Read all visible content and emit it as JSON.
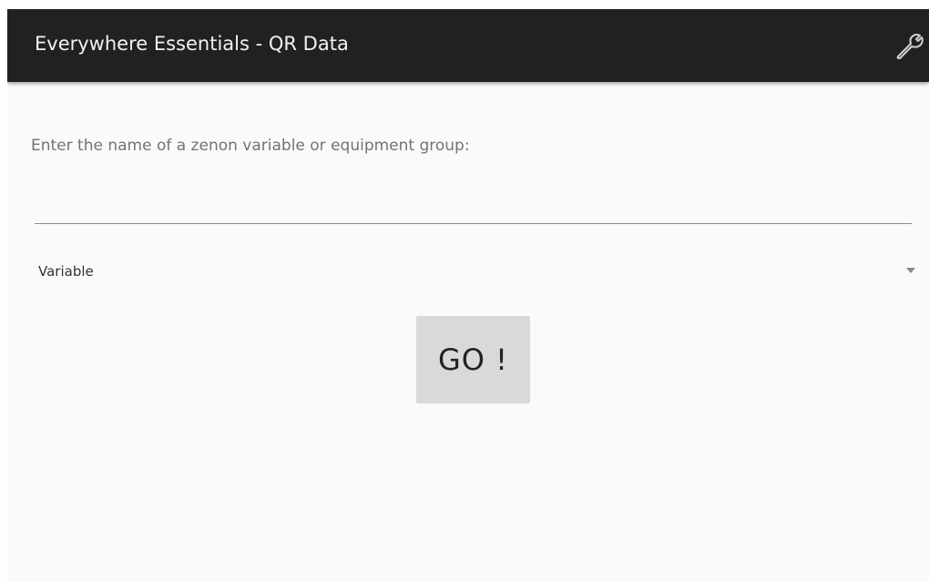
{
  "appbar": {
    "title": "Everywhere Essentials - QR Data",
    "settings_icon": "wrench-icon",
    "background": "#212121"
  },
  "form": {
    "prompt": "Enter the name of a zenon variable or equipment group:",
    "name_input": {
      "value": "",
      "placeholder": ""
    },
    "type_select": {
      "selected": "Variable",
      "icon": "dropdown-arrow-icon"
    },
    "go_label": "GO !"
  },
  "colors": {
    "background": "#fafafa",
    "button": "#d8d9d8"
  }
}
